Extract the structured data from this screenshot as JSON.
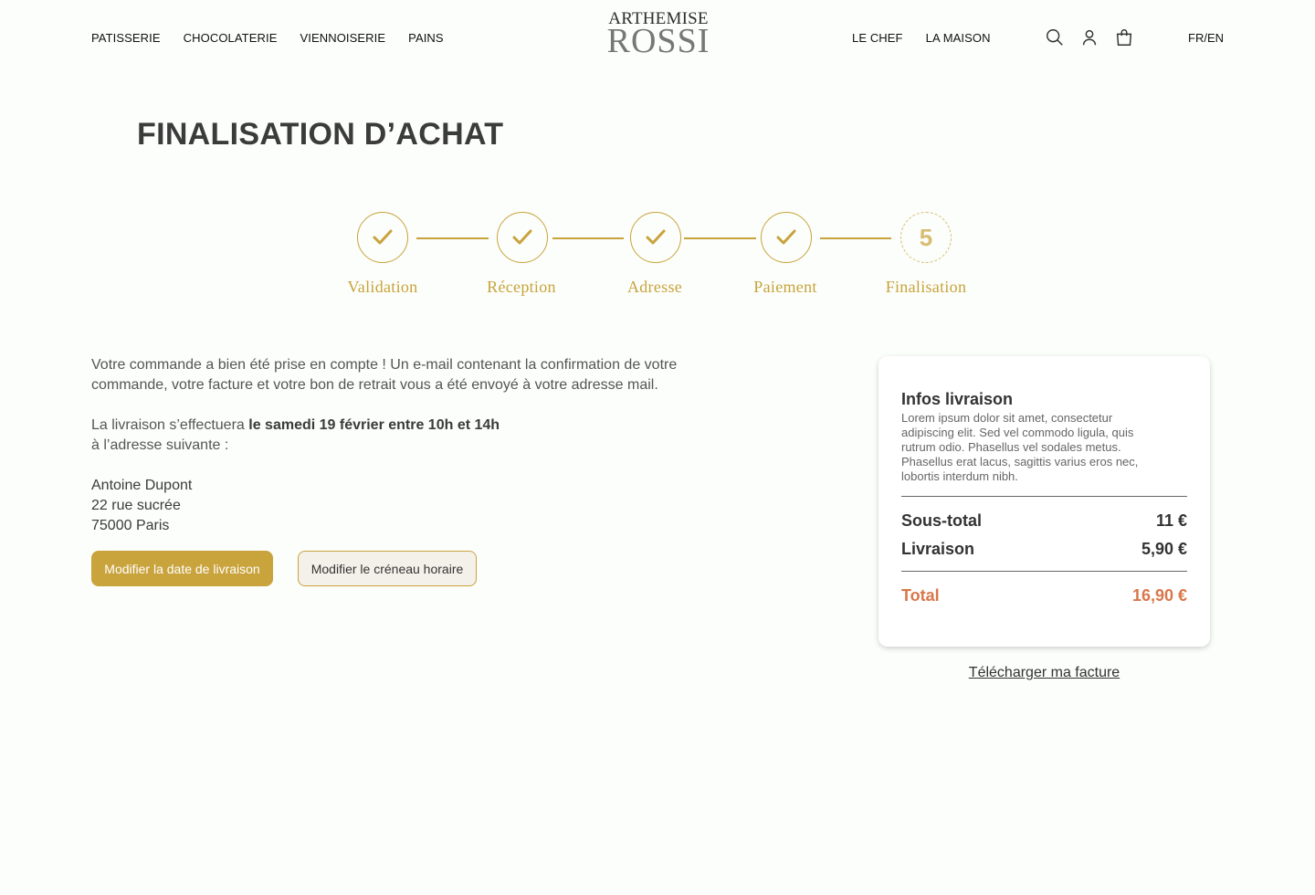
{
  "nav": {
    "left": [
      "PATISSERIE",
      "CHOCOLATERIE",
      "VIENNOISERIE",
      "PAINS"
    ],
    "logo_line1": "ARTHEMISE",
    "logo_line2": "ROSSI",
    "right": [
      "LE CHEF",
      "LA MAISON"
    ],
    "icons": [
      "search-icon",
      "user-icon",
      "cart-icon"
    ],
    "lang": "FR/EN"
  },
  "page": {
    "title": "FINALISATION D’ACHAT"
  },
  "stepper": {
    "steps": [
      {
        "label": "Validation",
        "status": "done"
      },
      {
        "label": "Réception",
        "status": "done"
      },
      {
        "label": "Adresse",
        "status": "done"
      },
      {
        "label": "Paiement",
        "status": "done"
      },
      {
        "label": "Finalisation",
        "status": "current",
        "number": "5"
      }
    ]
  },
  "confirmation": {
    "message": "Votre commande a bien été prise en compte ! Un e-mail contenant la confirmation de votre commande, votre facture et votre bon de retrait vous a été envoyé à votre adresse mail.",
    "delivery_prefix": "La livraison s’effectuera ",
    "delivery_date": "le samedi 19 février entre 10h et 14h",
    "delivery_suffix": "à l’adresse suivante :",
    "address": [
      "Antoine Dupont",
      "22 rue sucrée",
      "75000 Paris"
    ],
    "btn_date": "Modifier la date de livraison",
    "btn_slot": "Modifier le créneau horaire"
  },
  "summary": {
    "title": "Infos livraison",
    "description": "Lorem ipsum dolor sit amet, consectetur adipiscing elit. Sed vel commodo ligula, quis rutrum odio. Phasellus vel sodales metus. Phasellus erat lacus, sagittis varius eros nec, lobortis interdum nibh.",
    "subtotal_label": "Sous-total",
    "subtotal_value": "11 €",
    "shipping_label": "Livraison",
    "shipping_value": "5,90 €",
    "total_label": "Total",
    "total_value": "16,90 €",
    "download": "Télécharger ma facture"
  },
  "colors": {
    "gold": "#c9a33c",
    "total": "#d9774a",
    "background": "#fbfefa"
  }
}
